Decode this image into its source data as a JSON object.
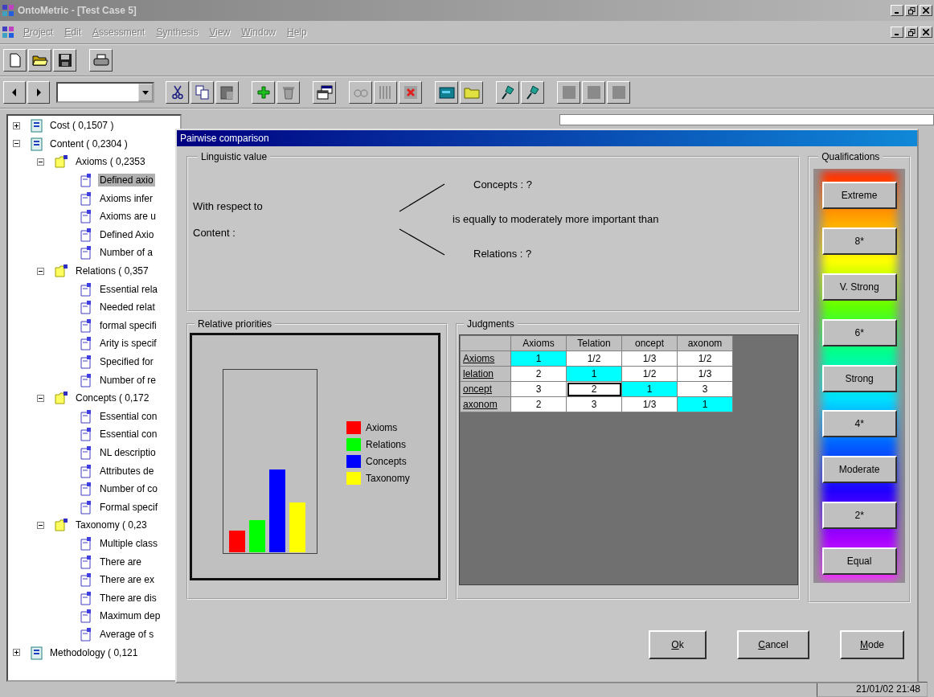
{
  "window": {
    "title": "OntoMetric - [Test Case 5]"
  },
  "menu": [
    "Project",
    "Edit",
    "Assessment",
    "Synthesis",
    "View",
    "Window",
    "Help"
  ],
  "tree": [
    {
      "label": "Cost ( 0,1507 )",
      "kind": "criterion",
      "expanded": false,
      "selected": false
    },
    {
      "label": "Content ( 0,2304 )",
      "kind": "criterion",
      "expanded": true,
      "selected": false,
      "children": [
        {
          "label": "Axioms ( 0,2353",
          "kind": "group",
          "expanded": true,
          "selected": false,
          "children": [
            {
              "label": "Defined axio",
              "kind": "leaf",
              "selected": true
            },
            {
              "label": "Axioms infer",
              "kind": "leaf",
              "selected": false
            },
            {
              "label": "Axioms are u",
              "kind": "leaf",
              "selected": false
            },
            {
              "label": "Defined Axio",
              "kind": "leaf",
              "selected": false
            },
            {
              "label": "Number of a",
              "kind": "leaf",
              "selected": false
            }
          ]
        },
        {
          "label": "Relations ( 0,357",
          "kind": "group",
          "expanded": true,
          "selected": false,
          "children": [
            {
              "label": "Essential rela",
              "kind": "leaf",
              "selected": false
            },
            {
              "label": "Needed relat",
              "kind": "leaf",
              "selected": false
            },
            {
              "label": "formal specifi",
              "kind": "leaf",
              "selected": false
            },
            {
              "label": "Arity is specif",
              "kind": "leaf",
              "selected": false
            },
            {
              "label": "Specified for",
              "kind": "leaf",
              "selected": false
            },
            {
              "label": "Number of re",
              "kind": "leaf",
              "selected": false
            }
          ]
        },
        {
          "label": "Concepts ( 0,172",
          "kind": "group",
          "expanded": true,
          "selected": false,
          "children": [
            {
              "label": "Essential con",
              "kind": "leaf",
              "selected": false
            },
            {
              "label": "Essential con",
              "kind": "leaf",
              "selected": false
            },
            {
              "label": "NL descriptio",
              "kind": "leaf",
              "selected": false
            },
            {
              "label": "Attributes de",
              "kind": "leaf",
              "selected": false
            },
            {
              "label": "Number of co",
              "kind": "leaf",
              "selected": false
            },
            {
              "label": "Formal specif",
              "kind": "leaf",
              "selected": false
            }
          ]
        },
        {
          "label": "Taxonomy ( 0,23",
          "kind": "group",
          "expanded": true,
          "selected": false,
          "children": [
            {
              "label": "Multiple class",
              "kind": "leaf",
              "selected": false
            },
            {
              "label": "There are",
              "kind": "leaf",
              "selected": false
            },
            {
              "label": "There are ex",
              "kind": "leaf",
              "selected": false
            },
            {
              "label": "There are dis",
              "kind": "leaf",
              "selected": false
            },
            {
              "label": "Maximum dep",
              "kind": "leaf",
              "selected": false
            },
            {
              "label": "Average of s",
              "kind": "leaf",
              "selected": false
            }
          ]
        }
      ]
    },
    {
      "label": "Methodology ( 0,121",
      "kind": "criterion",
      "expanded": false,
      "selected": false
    }
  ],
  "dialog": {
    "title": "Pairwise comparison",
    "linguistic": {
      "title": "Linguistic value",
      "respect_label": "With respect to",
      "criterion": "Content :",
      "first": "Concepts : ?",
      "relation": "is equally to moderately more important than",
      "second": "Relations : ?"
    },
    "priorities": {
      "title": "Relative priorities",
      "legend": [
        {
          "label": "Axioms",
          "color": "#ff0000"
        },
        {
          "label": "Relations",
          "color": "#00ff00"
        },
        {
          "label": "Concepts",
          "color": "#0000ff"
        },
        {
          "label": "Taxonomy",
          "color": "#ffff00"
        }
      ]
    },
    "judgments": {
      "title": "Judgments",
      "columns": [
        "Axioms",
        "Telation",
        "oncept",
        "axonom"
      ],
      "rows": [
        {
          "header": "Axioms",
          "cells": [
            {
              "value": "1",
              "highlighted": true,
              "selected": false
            },
            {
              "value": "1/2",
              "highlighted": false,
              "selected": false
            },
            {
              "value": "1/3",
              "highlighted": false,
              "selected": false
            },
            {
              "value": "1/2",
              "highlighted": false,
              "selected": false
            }
          ]
        },
        {
          "header": "lelation",
          "cells": [
            {
              "value": "2",
              "highlighted": false,
              "selected": false
            },
            {
              "value": "1",
              "highlighted": true,
              "selected": false
            },
            {
              "value": "1/2",
              "highlighted": false,
              "selected": false
            },
            {
              "value": "1/3",
              "highlighted": false,
              "selected": false
            }
          ]
        },
        {
          "header": "oncept",
          "cells": [
            {
              "value": "3",
              "highlighted": false,
              "selected": false
            },
            {
              "value": "2",
              "highlighted": false,
              "selected": true
            },
            {
              "value": "1",
              "highlighted": true,
              "selected": false
            },
            {
              "value": "3",
              "highlighted": false,
              "selected": false
            }
          ]
        },
        {
          "header": "axonom",
          "cells": [
            {
              "value": "2",
              "highlighted": false,
              "selected": false
            },
            {
              "value": "3",
              "highlighted": false,
              "selected": false
            },
            {
              "value": "1/3",
              "highlighted": false,
              "selected": false
            },
            {
              "value": "1",
              "highlighted": true,
              "selected": false
            }
          ]
        }
      ]
    },
    "qualifications": {
      "title": "Qualifications",
      "buttons": [
        "Extreme",
        "8*",
        "V. Strong",
        "6*",
        "Strong",
        "4*",
        "Moderate",
        "2*",
        "Equal"
      ]
    },
    "buttons": [
      "Ok",
      "Cancel",
      "Mode"
    ]
  },
  "status_bar": {
    "datetime": "21/01/02 21:48"
  }
}
